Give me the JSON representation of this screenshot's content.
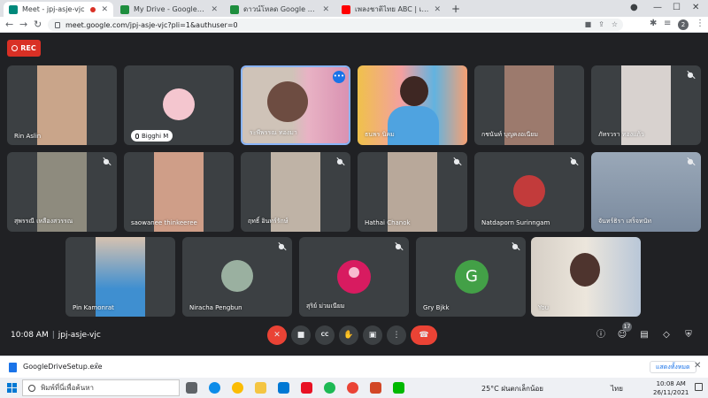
{
  "browser": {
    "tabs": [
      {
        "title": "Meet - jpj-asje-vjc",
        "favicon_color": "#00897b",
        "active": true,
        "recording": true
      },
      {
        "title": "My Drive - Google Drive",
        "favicon_color": "#1e8e3e",
        "active": false
      },
      {
        "title": "ดาวน์โหลด Google ไดรฟ์",
        "favicon_color": "#1e8e3e",
        "active": false
      },
      {
        "title": "เพลงชาติไทย ABC | เพลงเด็ก by KidsOn",
        "favicon_color": "#ff0000",
        "active": false
      }
    ],
    "new_tab_symbol": "+",
    "url": "meet.google.com/jpj-asje-vjc?pli=1&authuser=0",
    "profile_initial": "2"
  },
  "meet": {
    "rec_label": "REC",
    "accent_color": "#8ab4f8",
    "row1": [
      {
        "name": "Rin Aslin",
        "muted": false,
        "tone": "#c9a58a"
      },
      {
        "name": "Bigghi M",
        "muted": false,
        "chip": true,
        "tone": "#f4c6cf"
      },
      {
        "name": "ระพีพรรณ ทองมา",
        "muted": false,
        "active": true,
        "tone": "#e8b2c4"
      },
      {
        "name": "ธนพร นิคม",
        "muted": false,
        "tone": "#62b3e0"
      },
      {
        "name": "กชนันท์ บุญคงอเนียม",
        "muted": false,
        "tone": "#9c7a6d"
      },
      {
        "name": "ภัทรวรา ทองแก้ว",
        "muted": true,
        "tone": "#d8d2cf"
      }
    ],
    "row2": [
      {
        "name": "สุพรรณี เหลืองสวรรณ",
        "muted": true,
        "tone": "#8e8b7e"
      },
      {
        "name": "saowanee thinkeeree",
        "muted": false,
        "tone": "#cf9e88"
      },
      {
        "name": "ฤทธิ์ อินทร์รักษ์",
        "muted": true,
        "tone": "#bfb3a6"
      },
      {
        "name": "Hathai Chanok",
        "muted": true,
        "tone": "#b8a89a"
      },
      {
        "name": "Natdaporn Surinngam",
        "muted": true,
        "tone": "#c23b3b"
      },
      {
        "name": "จันทร์ธิรา เสร็จทนัท",
        "muted": true,
        "tone": "#7a8a9e"
      }
    ],
    "row3": [
      {
        "name": "Pin Kamonrat",
        "muted": false,
        "tone": "#3f8fd0"
      },
      {
        "name": "Niracha Pengbun",
        "muted": true,
        "tone": "#9ab0a0"
      },
      {
        "name": "สุริย์ ม่วมเนียม",
        "muted": true,
        "avatar_color": "#d81b60"
      },
      {
        "name": "Gry Bjkk",
        "muted": true,
        "initial": "G",
        "avatar_color": "#43a047"
      },
      {
        "name": "You",
        "muted": false,
        "tone": "#d6cfc6"
      }
    ],
    "time": "10:08 AM",
    "meeting_code": "jpj-asje-vjc",
    "participant_count": "17",
    "controls": [
      "mic-off",
      "camera",
      "cc",
      "raise-hand",
      "present",
      "more",
      "end-call"
    ]
  },
  "downloads": {
    "file_name": "GoogleDriveSetup.exe",
    "show_all_label": "แสดงทั้งหมด"
  },
  "taskbar": {
    "search_placeholder": "พิมพ์ที่นี่เพื่อค้นหา",
    "weather": "25°C ฝนตกเล็กน้อย",
    "language": "ไทย",
    "clock_time": "10:08 AM",
    "clock_date": "26/11/2021"
  }
}
